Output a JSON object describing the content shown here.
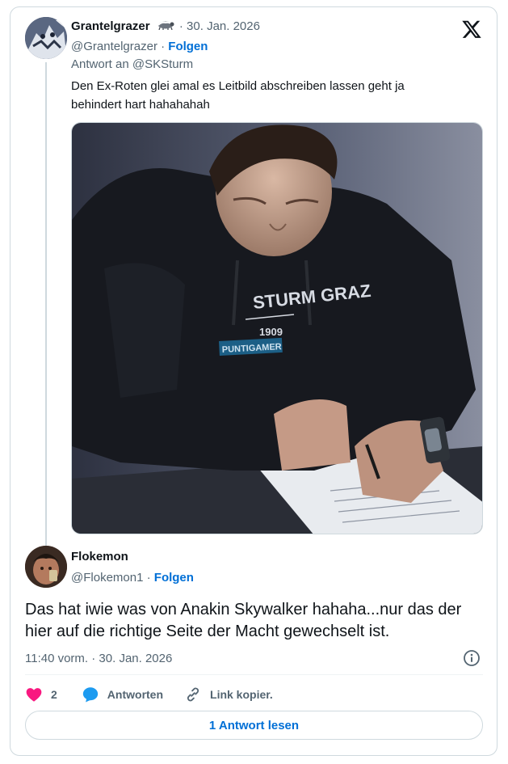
{
  "parent_tweet": {
    "display_name": "Grantelgrazer",
    "date": "· 30. Jan. 2026",
    "handle": "@Grantelgrazer",
    "separator": "·",
    "follow_label": "Folgen",
    "reply_to": "Antwort an @SKSturm",
    "text": "Den Ex-Roten glei amal es Leitbild abschreiben lassen geht ja behindert hart hahahahah",
    "image": {
      "hoodie_line1": "STURM GRAZ",
      "hoodie_line2": "1909",
      "hoodie_sponsor": "PUNTIGAMER"
    }
  },
  "main_tweet": {
    "display_name": "Flokemon",
    "handle": "@Flokemon1",
    "separator": "·",
    "follow_label": "Folgen",
    "text": "Das hat iwie was von Anakin Skywalker hahaha...nur das der hier auf die richtige Seite der Macht gewechselt ist.",
    "timestamp": "11:40 vorm. · 30. Jan. 2026",
    "like_count": "2",
    "reply_label": "Antworten",
    "copy_link_label": "Link kopier.",
    "read_replies_label": "1 Antwort lesen"
  },
  "colors": {
    "link_blue": "#006fd6",
    "like_pink": "#f91880",
    "reply_blue": "#1d9bf0",
    "muted": "#536471",
    "border": "#cfd9de"
  },
  "icons": [
    "x-logo-icon",
    "heart-icon",
    "reply-bubble-icon",
    "link-icon",
    "info-icon"
  ]
}
